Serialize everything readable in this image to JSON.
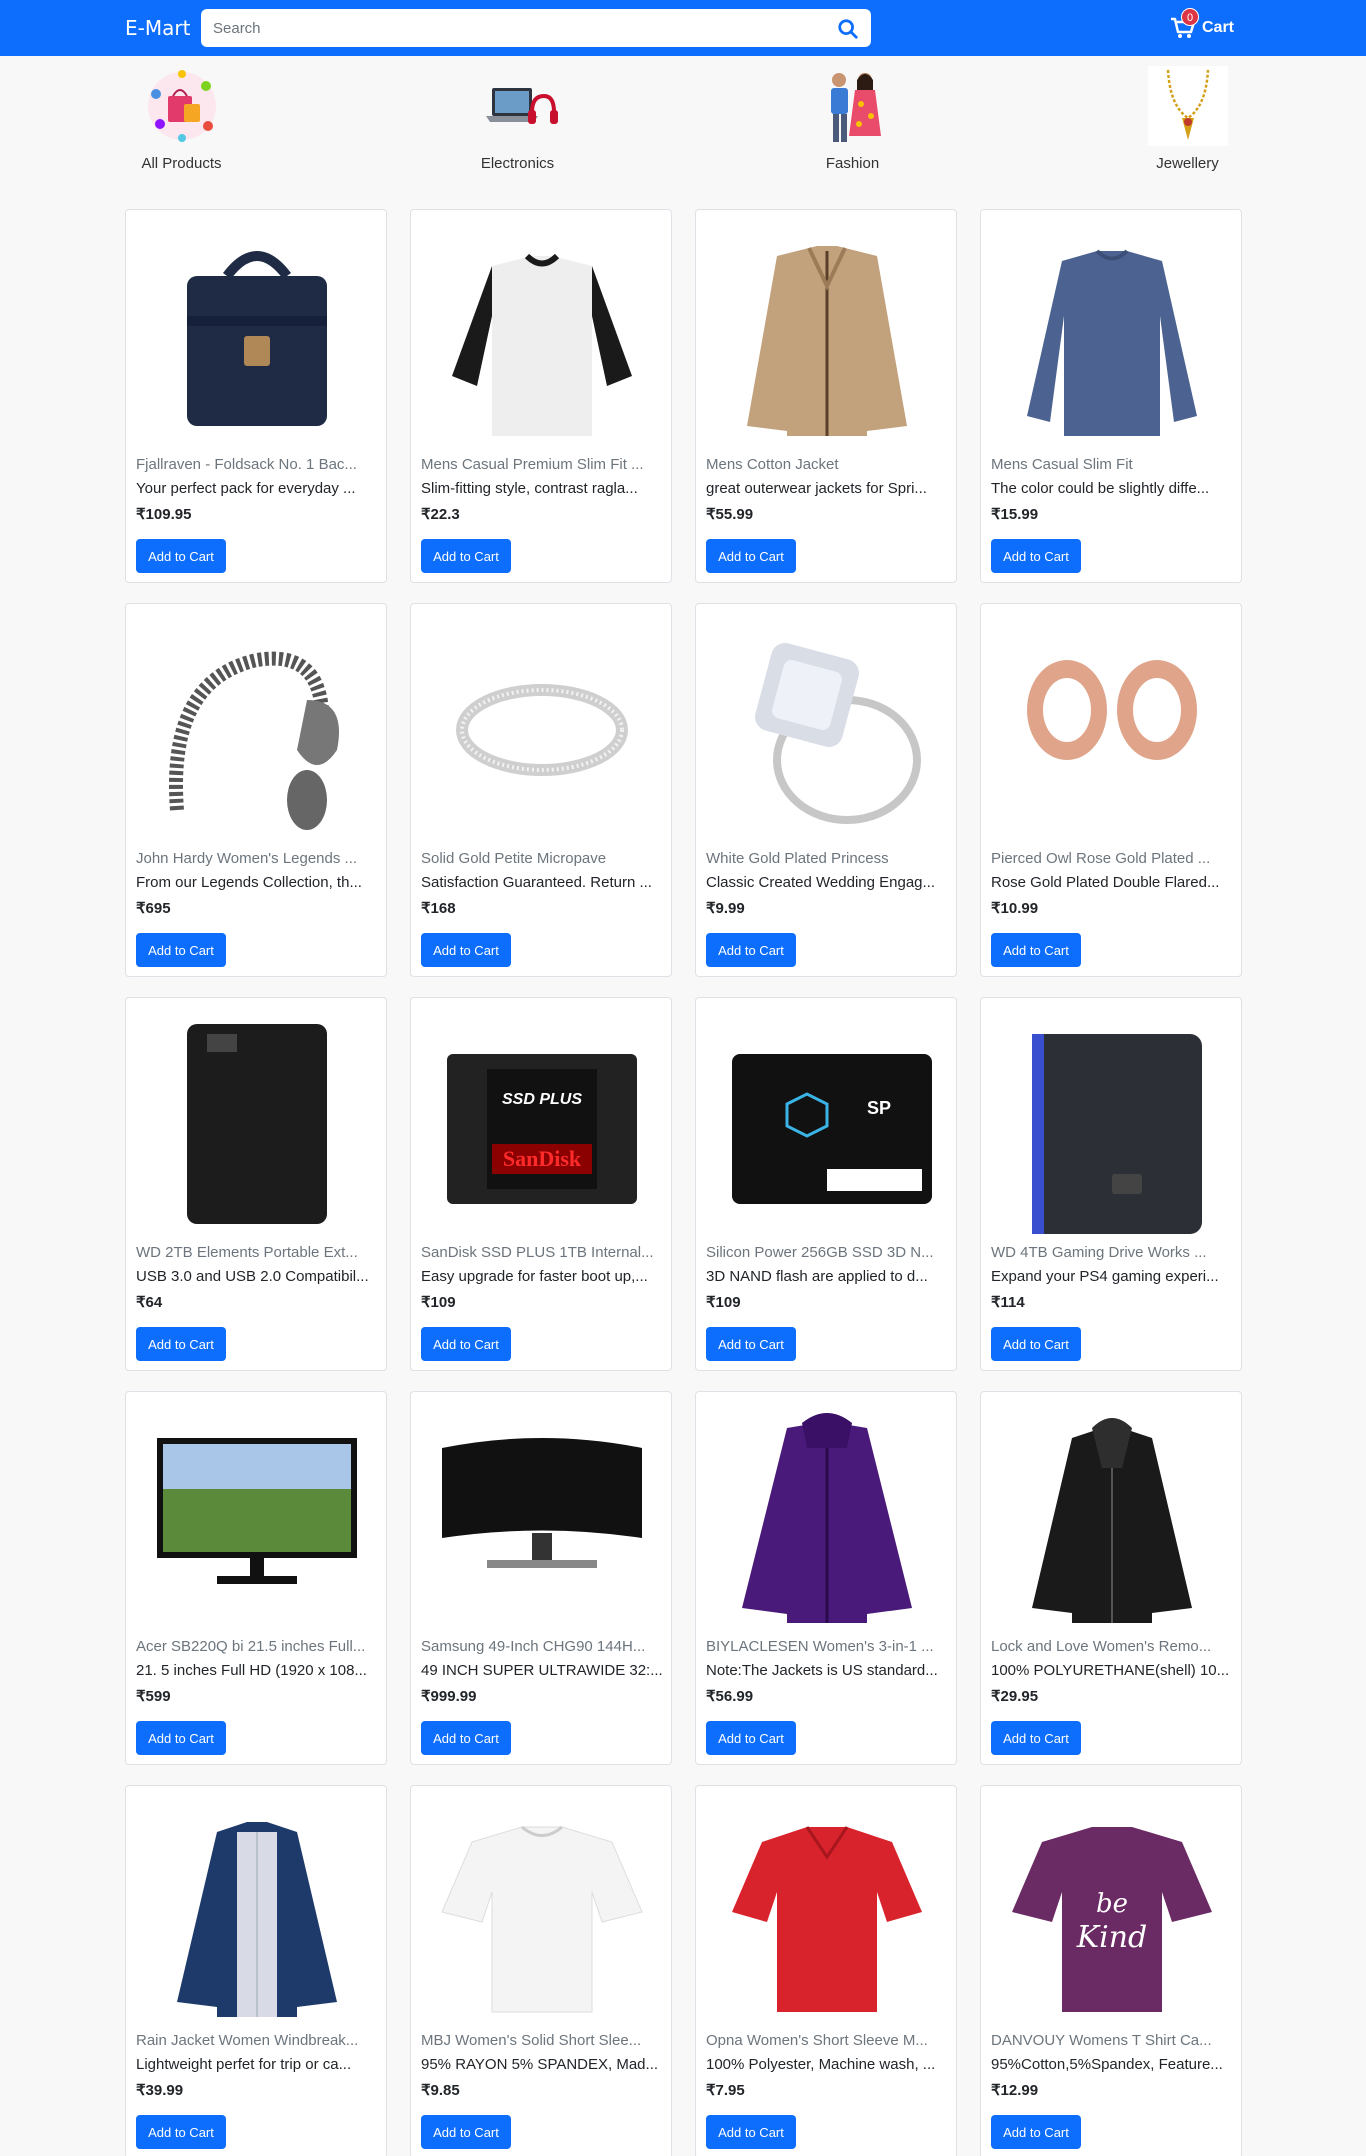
{
  "navbar": {
    "brand": "E-Mart",
    "search_placeholder": "Search",
    "cart_count": "0",
    "cart_label": "Cart"
  },
  "categories": [
    {
      "label": "All Products",
      "icon": "shopping-collage-icon"
    },
    {
      "label": "Electronics",
      "icon": "laptop-headphones-icon"
    },
    {
      "label": "Fashion",
      "icon": "fashion-couple-icon"
    },
    {
      "label": "Jewellery",
      "icon": "necklace-icon"
    }
  ],
  "add_to_cart_label": "Add to Cart",
  "colors": {
    "primary": "#0d6efd",
    "badge": "#dc3545",
    "page_bg": "#f8f8f8"
  },
  "products": [
    {
      "title": "Fjallraven - Foldsack No. 1 Bac...",
      "desc": "Your perfect pack for everyday ...",
      "price": "₹109.95",
      "image": "backpack"
    },
    {
      "title": "Mens Casual Premium Slim Fit ...",
      "desc": "Slim-fitting style, contrast ragla...",
      "price": "₹22.3",
      "image": "raglan-tee"
    },
    {
      "title": "Mens Cotton Jacket",
      "desc": "great outerwear jackets for Spri...",
      "price": "₹55.99",
      "image": "cotton-jacket"
    },
    {
      "title": "Mens Casual Slim Fit",
      "desc": "The color could be slightly diffe...",
      "price": "₹15.99",
      "image": "slim-fit-tee"
    },
    {
      "title": "John Hardy Women's Legends ...",
      "desc": "From our Legends Collection, th...",
      "price": "₹695",
      "image": "dragon-bracelet"
    },
    {
      "title": "Solid Gold Petite Micropave",
      "desc": "Satisfaction Guaranteed. Return ...",
      "price": "₹168",
      "image": "micropave-ring"
    },
    {
      "title": "White Gold Plated Princess",
      "desc": "Classic Created Wedding Engag...",
      "price": "₹9.99",
      "image": "princess-ring"
    },
    {
      "title": "Pierced Owl Rose Gold Plated ...",
      "desc": "Rose Gold Plated Double Flared...",
      "price": "₹10.99",
      "image": "rose-gold-plugs"
    },
    {
      "title": "WD 2TB Elements Portable Ext...",
      "desc": "USB 3.0 and USB 2.0 Compatibil...",
      "price": "₹64",
      "image": "wd-portable-drive"
    },
    {
      "title": "SanDisk SSD PLUS 1TB Internal...",
      "desc": "Easy upgrade for faster boot up,...",
      "price": "₹109",
      "image": "sandisk-ssd"
    },
    {
      "title": "Silicon Power 256GB SSD 3D N...",
      "desc": "3D NAND flash are applied to d...",
      "price": "₹109",
      "image": "silicon-power-ssd"
    },
    {
      "title": "WD 4TB Gaming Drive Works ...",
      "desc": "Expand your PS4 gaming experi...",
      "price": "₹114",
      "image": "wd-gaming-drive"
    },
    {
      "title": "Acer SB220Q bi 21.5 inches Full...",
      "desc": "21. 5 inches Full HD (1920 x 108...",
      "price": "₹599",
      "image": "acer-monitor"
    },
    {
      "title": "Samsung 49-Inch CHG90 144H...",
      "desc": "49 INCH SUPER ULTRAWIDE 32:...",
      "price": "₹999.99",
      "image": "samsung-ultrawide"
    },
    {
      "title": "BIYLACLESEN Women's 3-in-1 ...",
      "desc": "Note:The Jackets is US standard...",
      "price": "₹56.99",
      "image": "purple-jacket"
    },
    {
      "title": "Lock and Love Women's Remo...",
      "desc": "100% POLYURETHANE(shell) 10...",
      "price": "₹29.95",
      "image": "leather-jacket"
    },
    {
      "title": "Rain Jacket Women Windbreak...",
      "desc": "Lightweight perfet for trip or ca...",
      "price": "₹39.99",
      "image": "rain-jacket"
    },
    {
      "title": "MBJ Women's Solid Short Slee...",
      "desc": "95% RAYON 5% SPANDEX, Mad...",
      "price": "₹9.85",
      "image": "white-tee"
    },
    {
      "title": "Opna Women's Short Sleeve M...",
      "desc": "100% Polyester, Machine wash, ...",
      "price": "₹7.95",
      "image": "red-tee"
    },
    {
      "title": "DANVOUY Womens T Shirt Ca...",
      "desc": "95%Cotton,5%Spandex, Feature...",
      "price": "₹12.99",
      "image": "purple-tee"
    }
  ]
}
